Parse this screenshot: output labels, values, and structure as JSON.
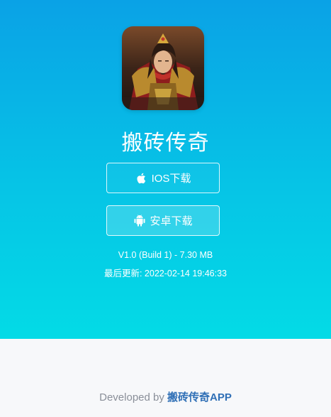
{
  "app": {
    "title": "搬砖传奇",
    "icon_name": "app-logo-icon"
  },
  "buttons": {
    "ios_label": "IOS下载",
    "ios_icon": "apple-icon",
    "android_label": "安卓下载",
    "android_icon": "android-icon"
  },
  "info": {
    "version_line": "V1.0 (Build 1) - 7.30 MB",
    "updated_line": "最后更新: 2022-02-14 19:46:33"
  },
  "footer": {
    "prefix": "Developed by",
    "developer": "搬砖传奇APP"
  },
  "colors": {
    "gradient_top": "#0aa2e6",
    "gradient_bottom": "#03dbe6",
    "footer_bg": "#f7f8fa",
    "link": "#2f6fb6"
  }
}
